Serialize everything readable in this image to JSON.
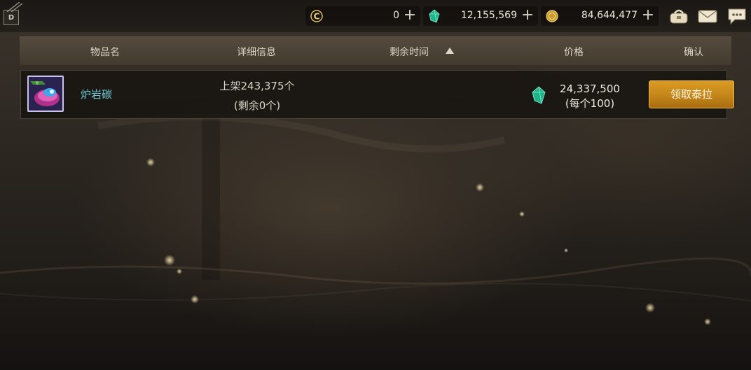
{
  "currencies": [
    {
      "icon": "c-coin-icon",
      "value": "0",
      "add_label": "+"
    },
    {
      "icon": "green-gem-icon",
      "value": "12,155,569",
      "add_label": "+"
    },
    {
      "icon": "gold-coin-icon",
      "value": "84,644,477",
      "add_label": "+"
    }
  ],
  "corner_badge": "D",
  "top_buttons": [
    "pouch-icon",
    "mail-icon",
    "chat-icon"
  ],
  "columns": {
    "item_name": "物品名",
    "details": "详细信息",
    "time_left": "剩余时间",
    "price": "价格",
    "confirm": "确认"
  },
  "items": [
    {
      "name": "炉岩碳",
      "detail_listed": "上架243,375个",
      "detail_remaining": "(剩余0个)",
      "price": "24,337,500",
      "price_unit": "(每个100)",
      "action": "领取泰拉",
      "icon_badge": "兑"
    }
  ],
  "colors": {
    "accent": "#c98d1d",
    "item_name": "#6fc9d7",
    "gem": "#2fd0a0"
  }
}
